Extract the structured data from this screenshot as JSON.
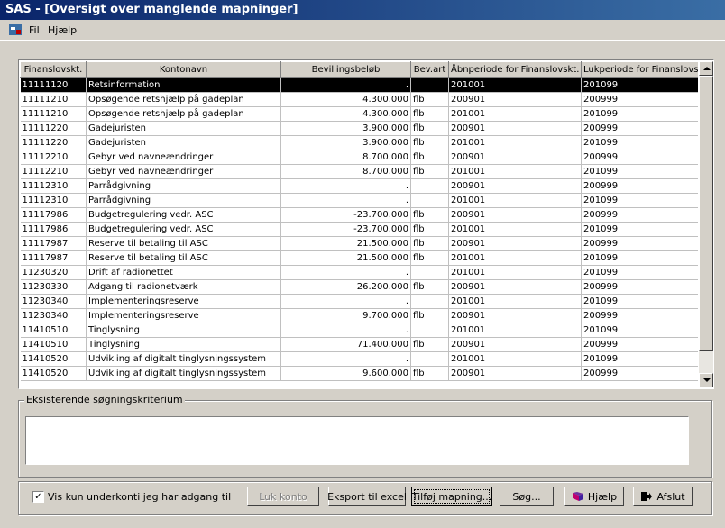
{
  "window": {
    "title": "SAS - [Oversigt over manglende mapninger]"
  },
  "menu": {
    "items": [
      {
        "label": "Fil"
      },
      {
        "label": "Hjælp"
      }
    ]
  },
  "grid": {
    "columns": [
      "Finanslovskt.",
      "Kontonavn",
      "Bevillingsbeløb",
      "Bev.art",
      "Åbnperiode for Finanslovskt.",
      "Lukperiode for Finanslovskt."
    ],
    "rows": [
      {
        "fin": "11111120",
        "name": "Retsinformation",
        "amount": ".",
        "art": "",
        "open": "201001",
        "close": "201099"
      },
      {
        "fin": "11111210",
        "name": "Opsøgende retshjælp på gadeplan",
        "amount": "4.300.000",
        "art": "flb",
        "open": "200901",
        "close": "200999"
      },
      {
        "fin": "11111210",
        "name": "Opsøgende retshjælp på gadeplan",
        "amount": "4.300.000",
        "art": "flb",
        "open": "201001",
        "close": "201099"
      },
      {
        "fin": "11111220",
        "name": "Gadejuristen",
        "amount": "3.900.000",
        "art": "flb",
        "open": "200901",
        "close": "200999"
      },
      {
        "fin": "11111220",
        "name": "Gadejuristen",
        "amount": "3.900.000",
        "art": "flb",
        "open": "201001",
        "close": "201099"
      },
      {
        "fin": "11112210",
        "name": "Gebyr ved navneændringer",
        "amount": "8.700.000",
        "art": "flb",
        "open": "200901",
        "close": "200999"
      },
      {
        "fin": "11112210",
        "name": "Gebyr ved navneændringer",
        "amount": "8.700.000",
        "art": "flb",
        "open": "201001",
        "close": "201099"
      },
      {
        "fin": "11112310",
        "name": "Parrådgivning",
        "amount": ".",
        "art": "",
        "open": "200901",
        "close": "200999"
      },
      {
        "fin": "11112310",
        "name": "Parrådgivning",
        "amount": ".",
        "art": "",
        "open": "201001",
        "close": "201099"
      },
      {
        "fin": "11117986",
        "name": "Budgetregulering vedr. ASC",
        "amount": "-23.700.000",
        "art": "flb",
        "open": "200901",
        "close": "200999"
      },
      {
        "fin": "11117986",
        "name": "Budgetregulering vedr. ASC",
        "amount": "-23.700.000",
        "art": "flb",
        "open": "201001",
        "close": "201099"
      },
      {
        "fin": "11117987",
        "name": "Reserve til betaling til ASC",
        "amount": "21.500.000",
        "art": "flb",
        "open": "200901",
        "close": "200999"
      },
      {
        "fin": "11117987",
        "name": "Reserve til betaling til ASC",
        "amount": "21.500.000",
        "art": "flb",
        "open": "201001",
        "close": "201099"
      },
      {
        "fin": "11230320",
        "name": "Drift af radionettet",
        "amount": ".",
        "art": "",
        "open": "201001",
        "close": "201099"
      },
      {
        "fin": "11230330",
        "name": "Adgang til radionetværk",
        "amount": "26.200.000",
        "art": "flb",
        "open": "200901",
        "close": "200999"
      },
      {
        "fin": "11230340",
        "name": "Implementeringsreserve",
        "amount": ".",
        "art": "",
        "open": "201001",
        "close": "201099"
      },
      {
        "fin": "11230340",
        "name": "Implementeringsreserve",
        "amount": "9.700.000",
        "art": "flb",
        "open": "200901",
        "close": "200999"
      },
      {
        "fin": "11410510",
        "name": "Tinglysning",
        "amount": ".",
        "art": "",
        "open": "201001",
        "close": "201099"
      },
      {
        "fin": "11410510",
        "name": "Tinglysning",
        "amount": "71.400.000",
        "art": "flb",
        "open": "200901",
        "close": "200999"
      },
      {
        "fin": "11410520",
        "name": "Udvikling af digitalt tinglysningssystem",
        "amount": ".",
        "art": "",
        "open": "201001",
        "close": "201099"
      },
      {
        "fin": "11410520",
        "name": "Udvikling af digitalt tinglysningssystem",
        "amount": "9.600.000",
        "art": "flb",
        "open": "200901",
        "close": "200999"
      }
    ]
  },
  "criteria": {
    "label": "Eksisterende søgningskriterium",
    "value": ""
  },
  "footer": {
    "checkbox_label": "Vis kun underkonti jeg har adgang til",
    "checkbox_checked": true,
    "buttons": {
      "close_account": "Luk konto",
      "export": "Eksport til excel",
      "add_mapping": "Tilføj mapning...",
      "search": "Søg...",
      "help": "Hjælp",
      "exit": "Afslut"
    }
  }
}
